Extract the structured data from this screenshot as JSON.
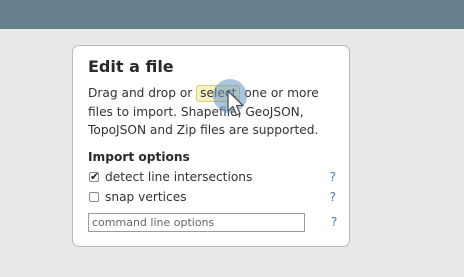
{
  "header": {},
  "dialog": {
    "title": "Edit a file",
    "description": {
      "before": "Drag and drop or ",
      "select_label": "select",
      "after": " one or more files to import. Shapefile, GeoJSON, TopoJSON and Zip files are supported."
    },
    "import_options": {
      "heading": "Import options",
      "options": [
        {
          "label": "detect line intersections",
          "checked": true,
          "help": "?"
        },
        {
          "label": "snap vertices",
          "checked": false,
          "help": "?"
        }
      ],
      "command_line": {
        "placeholder": "command line options",
        "value": "",
        "help": "?"
      }
    }
  },
  "colors": {
    "header_bar": "#657f8d",
    "background": "#e9e9e9",
    "select_highlight": "#f7f1c1",
    "help_link": "#4a7fb3",
    "cursor_highlight": "#6796c4"
  },
  "icons": {
    "check": "✔",
    "cursor": "pointer-arrow-icon"
  }
}
